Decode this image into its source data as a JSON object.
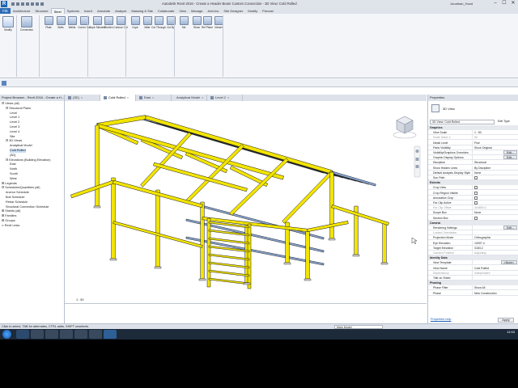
{
  "window": {
    "title": "Autodesk Revit 2016 - Create a Header Beam Custom Connection - 3D View: Cold Rolled",
    "user": "Jonathan_Hood",
    "minimize": "–",
    "maximize": "☐",
    "close": "✕"
  },
  "ribbon_tabs": [
    "Architecture",
    "Structure",
    "Steel",
    "Systems",
    "Insert",
    "Annotate",
    "Analyze",
    "Massing & Site",
    "Collaborate",
    "View",
    "Manage",
    "Add-Ins",
    "Site Designer",
    "Modify",
    "Precast"
  ],
  "file_tab": "File",
  "active_tab": "Steel",
  "ribbon_buttons": [
    {
      "label": "Modify",
      "name": "modify"
    },
    {
      "label": "Connection",
      "name": "connection"
    },
    {
      "label": "Plate",
      "name": "plate"
    },
    {
      "label": "Bolts",
      "name": "bolts"
    },
    {
      "label": "Welds",
      "name": "welds"
    },
    {
      "label": "Corner Cut",
      "name": "corner-cut"
    },
    {
      "label": "Cope Skewed",
      "name": "cope-skewed"
    },
    {
      "label": "Shorten",
      "name": "shorten"
    },
    {
      "label": "Contour Cut",
      "name": "contour-cut"
    },
    {
      "label": "Cope",
      "name": "cope"
    },
    {
      "label": "Miter",
      "name": "miter"
    },
    {
      "label": "Cut Through",
      "name": "cut-through"
    },
    {
      "label": "Cut By",
      "name": "cut-by"
    },
    {
      "label": "Set",
      "name": "set"
    },
    {
      "label": "Show",
      "name": "show"
    },
    {
      "label": "Ref Plane",
      "name": "ref-plane"
    },
    {
      "label": "Viewer",
      "name": "viewer"
    }
  ],
  "ribbon_panels": [
    "Select ▾",
    "Connection ▾",
    "Fabrication Elements",
    "Modifiers",
    "Parametric Cuts",
    "Work Plane"
  ],
  "view_tabs": [
    {
      "label": "{3D}",
      "active": false
    },
    {
      "label": "Cold Rolled",
      "active": true
    },
    {
      "label": "East",
      "active": false
    },
    {
      "label": "Analytical Model",
      "active": false
    },
    {
      "label": "Level 2",
      "active": false
    }
  ],
  "project_browser": {
    "title": "Project Browser - Revit 2016 - Create a H...",
    "items": [
      {
        "label": "⊟ Views (all)",
        "indent": 0
      },
      {
        "label": "⊟ Structural Plans",
        "indent": 1
      },
      {
        "label": "Level",
        "indent": 2
      },
      {
        "label": "Level 1",
        "indent": 2
      },
      {
        "label": "Level 2",
        "indent": 2
      },
      {
        "label": "Level 3",
        "indent": 2
      },
      {
        "label": "Level 4",
        "indent": 2
      },
      {
        "label": "Site",
        "indent": 2
      },
      {
        "label": "⊟ 3D Views",
        "indent": 1
      },
      {
        "label": "Analytical Model",
        "indent": 2
      },
      {
        "label": "Cold Rolled",
        "indent": 2,
        "selected": true
      },
      {
        "label": "{3D}",
        "indent": 2
      },
      {
        "label": "⊟ Elevations (Building Elevation)",
        "indent": 1
      },
      {
        "label": "East",
        "indent": 2
      },
      {
        "label": "North",
        "indent": 2
      },
      {
        "label": "South",
        "indent": 2
      },
      {
        "label": "West",
        "indent": 2
      },
      {
        "label": "⊞ Legends",
        "indent": 0
      },
      {
        "label": "⊟ Schedules/Quantities (all)",
        "indent": 0
      },
      {
        "label": "Anchor Schedule",
        "indent": 1
      },
      {
        "label": "Bolt Schedule",
        "indent": 1
      },
      {
        "label": "Rebar Schedule",
        "indent": 1
      },
      {
        "label": "Structural Connection Schedule",
        "indent": 1
      },
      {
        "label": "⊞ Sheets (all)",
        "indent": 0
      },
      {
        "label": "⊞ Families",
        "indent": 0
      },
      {
        "label": "⊞ Groups",
        "indent": 0
      },
      {
        "label": "∞ Revit Links",
        "indent": 0
      }
    ]
  },
  "view_scale": "1 : 50",
  "properties": {
    "title": "Properties",
    "type_name": "3D View",
    "instance_selector": "3D View: Cold Rolled",
    "edit_type": "Edit Type",
    "groups": [
      {
        "name": "Graphics",
        "rows": [
          {
            "k": "View Scale",
            "v": "1 : 50"
          },
          {
            "k": "Scale Value 1:",
            "v": "50",
            "grey": true
          },
          {
            "k": "Detail Level",
            "v": "Fine"
          },
          {
            "k": "Parts Visibility",
            "v": "Show Original"
          },
          {
            "k": "Visibility/Graphics Overrides",
            "v": "Edit...",
            "btn": true
          },
          {
            "k": "Graphic Display Options",
            "v": "Edit...",
            "btn": true
          },
          {
            "k": "Discipline",
            "v": "Structural"
          },
          {
            "k": "Show Hidden Lines",
            "v": "By Discipline"
          },
          {
            "k": "Default Analysis Display Style",
            "v": "None"
          },
          {
            "k": "Sun Path",
            "v": "",
            "chk": true
          }
        ]
      },
      {
        "name": "Extents",
        "rows": [
          {
            "k": "Crop View",
            "v": "",
            "chk": true
          },
          {
            "k": "Crop Region Visible",
            "v": "",
            "chk": true
          },
          {
            "k": "Annotation Crop",
            "v": "",
            "chk": true
          },
          {
            "k": "Far Clip Active",
            "v": "",
            "chk": true
          },
          {
            "k": "Far Clip Offset",
            "v": "304800.0",
            "grey": true
          },
          {
            "k": "Scope Box",
            "v": "None"
          },
          {
            "k": "Section Box",
            "v": "",
            "chk": true
          }
        ]
      },
      {
        "name": "Camera",
        "rows": [
          {
            "k": "Rendering Settings",
            "v": "Edit...",
            "btn": true
          },
          {
            "k": "Locked Orientation",
            "v": "",
            "grey": true
          },
          {
            "k": "Projection Mode",
            "v": "Orthographic"
          },
          {
            "k": "Eye Elevation",
            "v": "10907.4"
          },
          {
            "k": "Target Elevation",
            "v": "3183.2"
          },
          {
            "k": "Camera Position",
            "v": "Adjusting",
            "grey": true
          }
        ]
      },
      {
        "name": "Identity Data",
        "rows": [
          {
            "k": "View Template",
            "v": "<None>",
            "btn": true
          },
          {
            "k": "View Name",
            "v": "Cold Rolled"
          },
          {
            "k": "Dependency",
            "v": "Independent",
            "grey": true
          },
          {
            "k": "Title on Sheet",
            "v": ""
          }
        ]
      },
      {
        "name": "Phasing",
        "rows": [
          {
            "k": "Phase Filter",
            "v": "Show All"
          },
          {
            "k": "Phase",
            "v": "New Construction"
          }
        ]
      }
    ],
    "help_link": "Properties help",
    "apply": "Apply"
  },
  "status_bar": {
    "text": "Click to select, TAB for alternates, CTRL adds, SHIFT unselects.",
    "model": "Main Model"
  },
  "clock": {
    "time": "11:53",
    "date": ""
  },
  "colors": {
    "steel_column": "#f2e400",
    "steel_outline": "#1a1a1a",
    "purlin": "#8aa8d6",
    "accent": "#2b6cb6"
  }
}
